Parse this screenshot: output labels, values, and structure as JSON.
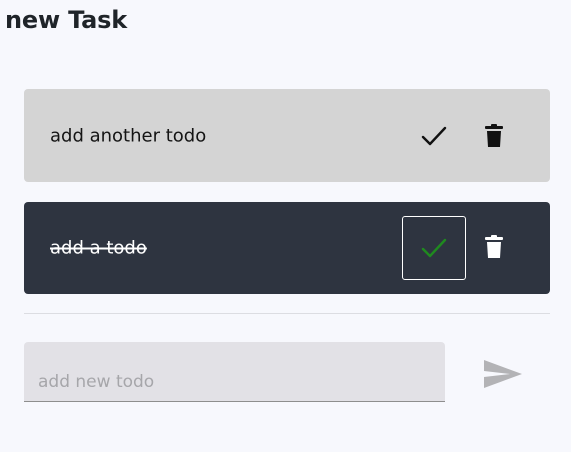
{
  "header": {
    "title": "new Task"
  },
  "todos": [
    {
      "text": "add another todo",
      "completed": false
    },
    {
      "text": "add a todo",
      "completed": true
    }
  ],
  "new_todo": {
    "placeholder": "add new todo",
    "value": ""
  },
  "icons": {
    "check": "check-icon",
    "trash": "trash-icon",
    "send": "send-icon"
  },
  "colors": {
    "background": "#f7f8fd",
    "todo_active_bg": "#d4d4d4",
    "todo_done_bg": "#2e3440",
    "done_check": "#1f8a1f",
    "send_icon": "#b3b3b6"
  }
}
